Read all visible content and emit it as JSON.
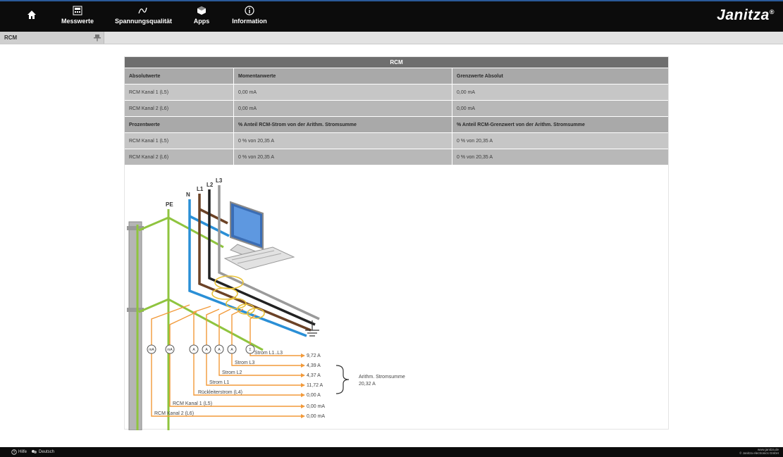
{
  "nav": {
    "items": [
      {
        "label": "Messwerte"
      },
      {
        "label": "Spannungsqualität"
      },
      {
        "label": "Apps"
      },
      {
        "label": "Information"
      }
    ],
    "brand": "Janitza",
    "brand_mark": "®"
  },
  "subbar": {
    "page": "RCM"
  },
  "table": {
    "title": "RCM",
    "abs_header": [
      "Absolutwerte",
      "Momentanwerte",
      "Grenzwerte Absolut"
    ],
    "abs_rows": [
      [
        "RCM Kanal 1 (L5)",
        "0,00 mA",
        "0,00 mA"
      ],
      [
        "RCM Kanal 2 (L6)",
        "0,00 mA",
        "0,00 mA"
      ]
    ],
    "pct_header": [
      "Prozentwerte",
      "% Anteil RCM-Strom von der Arithm. Stromsumme",
      "% Anteil RCM-Grenzwert von der Arithm. Stromsumme"
    ],
    "pct_rows": [
      [
        "RCM Kanal 1 (L5)",
        "0 % von 20,35 A",
        "0 % von 20,35 A"
      ],
      [
        "RCM Kanal 2 (L6)",
        "0 % von 20,35 A",
        "0 % von 20,35 A"
      ]
    ]
  },
  "diagram": {
    "conductors": {
      "pe": "PE",
      "n": "N",
      "l1": "L1",
      "l2": "L2",
      "l3": "L3"
    },
    "meters": {
      "ma": "mA",
      "a": "A",
      "sum": "Σ"
    },
    "labels": {
      "sum_l1_l3": "Strom L1..L3",
      "l3": "Strom L3",
      "l2": "Strom L2",
      "l1": "Strom L1",
      "return": "Rückleiterstrom (L4)",
      "rcm1": "RCM Kanal 1 (L5)",
      "rcm2": "RCM Kanal 2 (L6)"
    },
    "values": {
      "sum": "9,72 A",
      "l3": "4,39 A",
      "l2": "4,37 A",
      "l1": "11,72 A",
      "return": "0,00 A",
      "rcm1": "0,00 mA",
      "rcm2": "0,00 mA"
    },
    "arith_label": "Arithm. Stromsumme",
    "arith_value": "20,32 A"
  },
  "footer": {
    "help": "Hilfe",
    "language": "Deutsch",
    "url": "www.janitza.de",
    "company": "© Janitza electronics GmbH"
  },
  "colors": {
    "topbar": "#0c0c0c",
    "header_row": "#a9a9a9",
    "pe_green": "#8fc43f",
    "n_blue": "#2a8fd6",
    "l1_brown": "#6b4226",
    "l2_black": "#222222",
    "l3_grey": "#9a9a9a",
    "measure_orange": "#f29a3a"
  }
}
